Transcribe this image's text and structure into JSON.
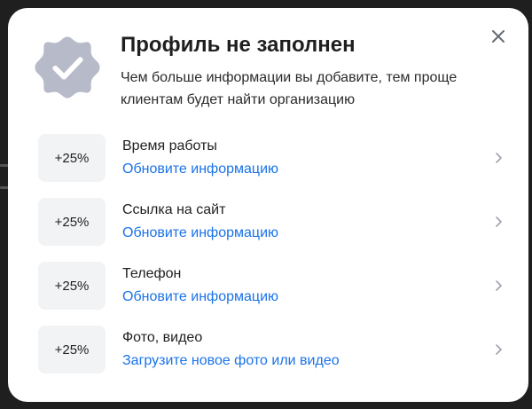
{
  "modal": {
    "title": "Профиль не заполнен",
    "subtitle": "Чем больше информации вы добавите, тем проще клиентам будет найти организацию",
    "badge_icon": "verified-check-badge-icon",
    "close_icon": "close-icon"
  },
  "rows": [
    {
      "percent": "+25%",
      "label": "Время работы",
      "link": "Обновите информацию"
    },
    {
      "percent": "+25%",
      "label": "Ссылка на сайт",
      "link": "Обновите информацию"
    },
    {
      "percent": "+25%",
      "label": "Телефон",
      "link": "Обновите информацию"
    },
    {
      "percent": "+25%",
      "label": "Фото, видео",
      "link": "Загрузите новое фото или видео"
    }
  ],
  "colors": {
    "link": "#1a73e8",
    "badge": "#b7bbc9",
    "percent_bg": "#f2f3f5",
    "backdrop": "#1f1f1f"
  }
}
